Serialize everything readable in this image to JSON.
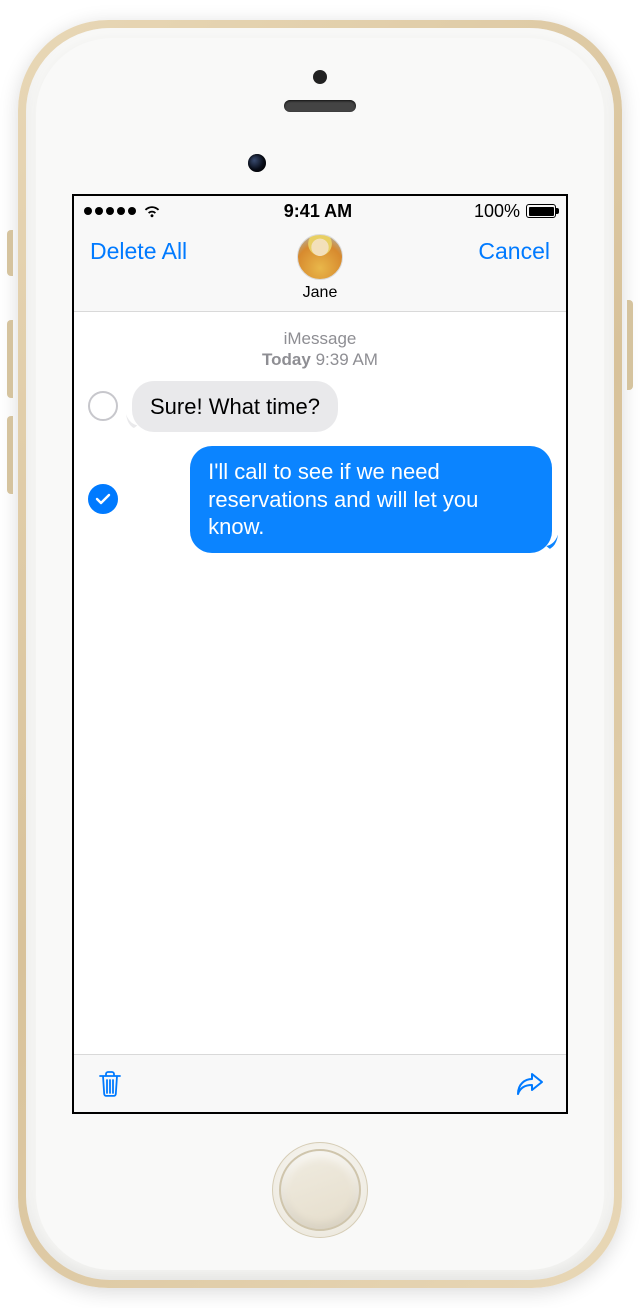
{
  "statusbar": {
    "signal_dots": 5,
    "time": "9:41 AM",
    "battery_percent": "100%"
  },
  "navbar": {
    "left_label": "Delete All",
    "right_label": "Cancel",
    "contact_name": "Jane"
  },
  "conversation": {
    "service": "iMessage",
    "timestamp_day": "Today",
    "timestamp_time": "9:39 AM"
  },
  "messages": [
    {
      "side": "received",
      "selected": false,
      "text": "Sure! What time?"
    },
    {
      "side": "sent",
      "selected": true,
      "text": "I'll call to see if we need reservations and will let you know."
    }
  ],
  "toolbar": {
    "trash_icon": "trash-icon",
    "share_icon": "share-icon"
  }
}
